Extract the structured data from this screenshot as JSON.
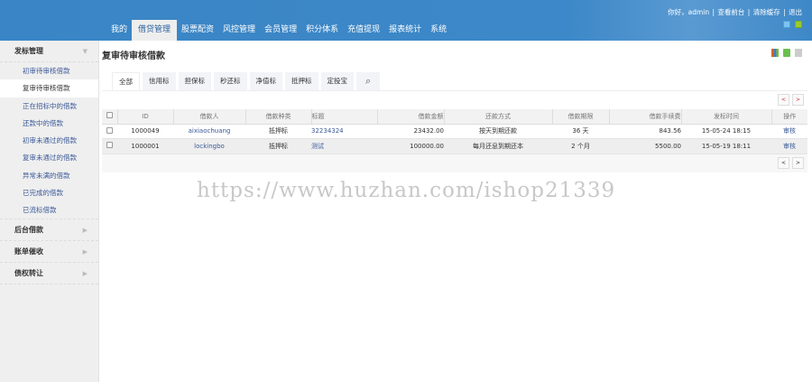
{
  "header": {
    "nav": [
      "我的",
      "借贷管理",
      "股票配资",
      "风控管理",
      "会员管理",
      "积分体系",
      "充值提现",
      "报表统计",
      "系统"
    ],
    "active_nav": 1,
    "greeting": "你好，admin",
    "links": [
      "查看前台",
      "清除缓存",
      "退出"
    ]
  },
  "sidebar": {
    "groups": [
      {
        "label": "发标管理",
        "expanded": true,
        "items": [
          "初审待审核借款",
          "复审待审核借款",
          "正在招标中的借款",
          "还款中的借款",
          "初审未通过的借款",
          "复审未通过的借款",
          "异常未满的借款",
          "已完成的借款",
          "已流标借款"
        ],
        "active": 1
      },
      {
        "label": "后台借款"
      },
      {
        "label": "账单催收"
      },
      {
        "label": "债权转让"
      }
    ]
  },
  "page": {
    "title": "复审待审核借款",
    "tabs": [
      "全部",
      "信用标",
      "担保标",
      "秒还标",
      "净值标",
      "抵押标",
      "定投宝"
    ],
    "active_tab": 0
  },
  "pager": {
    "prev": "<",
    "next": ">"
  },
  "table": {
    "headers": [
      "ID",
      "借款人",
      "借款种类",
      "标题",
      "借款金额",
      "还款方式",
      "借款期限",
      "借款手续费",
      "发标时间",
      "操作"
    ],
    "rows": [
      [
        "1000049",
        "aixiaochuang",
        "抵押标",
        "32234324",
        "23432.00",
        "按天到期还款",
        "36 天",
        "843.56",
        "15-05-24 18:15",
        "审核"
      ],
      [
        "1000001",
        "lockingbo",
        "抵押标",
        "测试",
        "100000.00",
        "每月还息到期还本",
        "2 个月",
        "5500.00",
        "15-05-19 18:11",
        "审核"
      ]
    ]
  },
  "watermark": "https://www.huzhan.com/ishop21339"
}
